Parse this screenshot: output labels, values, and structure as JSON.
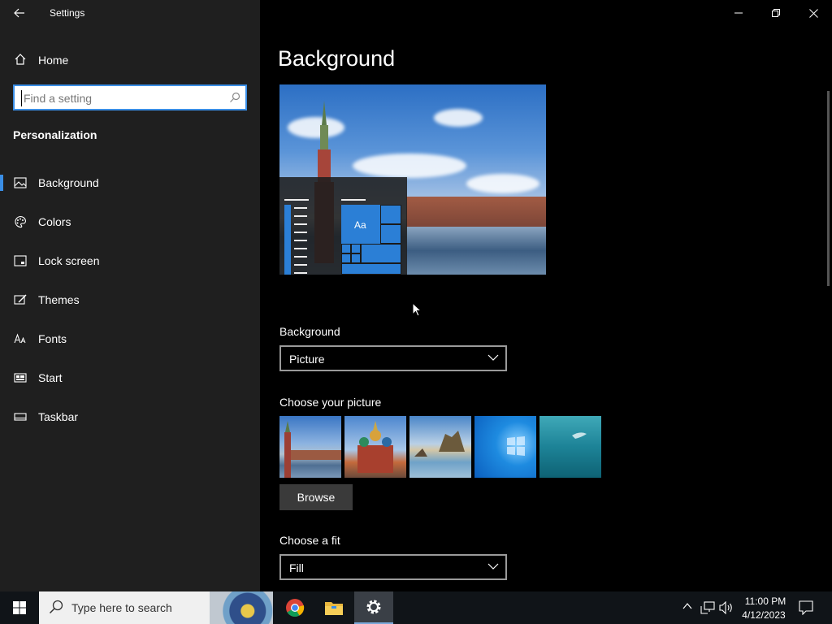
{
  "window": {
    "title": "Settings",
    "minimize_icon": "minimize-icon",
    "restore_icon": "restore-icon",
    "close_icon": "close-icon"
  },
  "sidebar": {
    "home_label": "Home",
    "search_placeholder": "Find a setting",
    "section_title": "Personalization",
    "items": [
      {
        "label": "Background",
        "icon": "picture-icon",
        "active": true
      },
      {
        "label": "Colors",
        "icon": "palette-icon",
        "active": false
      },
      {
        "label": "Lock screen",
        "icon": "lock-screen-icon",
        "active": false
      },
      {
        "label": "Themes",
        "icon": "themes-icon",
        "active": false
      },
      {
        "label": "Fonts",
        "icon": "fonts-icon",
        "active": false
      },
      {
        "label": "Start",
        "icon": "start-icon",
        "active": false
      },
      {
        "label": "Taskbar",
        "icon": "taskbar-icon",
        "active": false
      }
    ]
  },
  "main": {
    "page_title": "Background",
    "preview_tile_label": "Aa",
    "background_label": "Background",
    "background_value": "Picture",
    "choose_picture_label": "Choose your picture",
    "browse_label": "Browse",
    "choose_fit_label": "Choose a fit",
    "fit_value": "Fill"
  },
  "taskbar": {
    "search_placeholder": "Type here to search",
    "apps": [
      "chrome-icon",
      "file-explorer-icon",
      "settings-icon"
    ],
    "time": "11:00 PM",
    "date": "4/12/2023"
  },
  "colors": {
    "accent": "#3a8ee6",
    "sidebar_bg": "#1f1f1f",
    "main_bg": "#000000",
    "tile_blue": "#2b7fd6"
  }
}
